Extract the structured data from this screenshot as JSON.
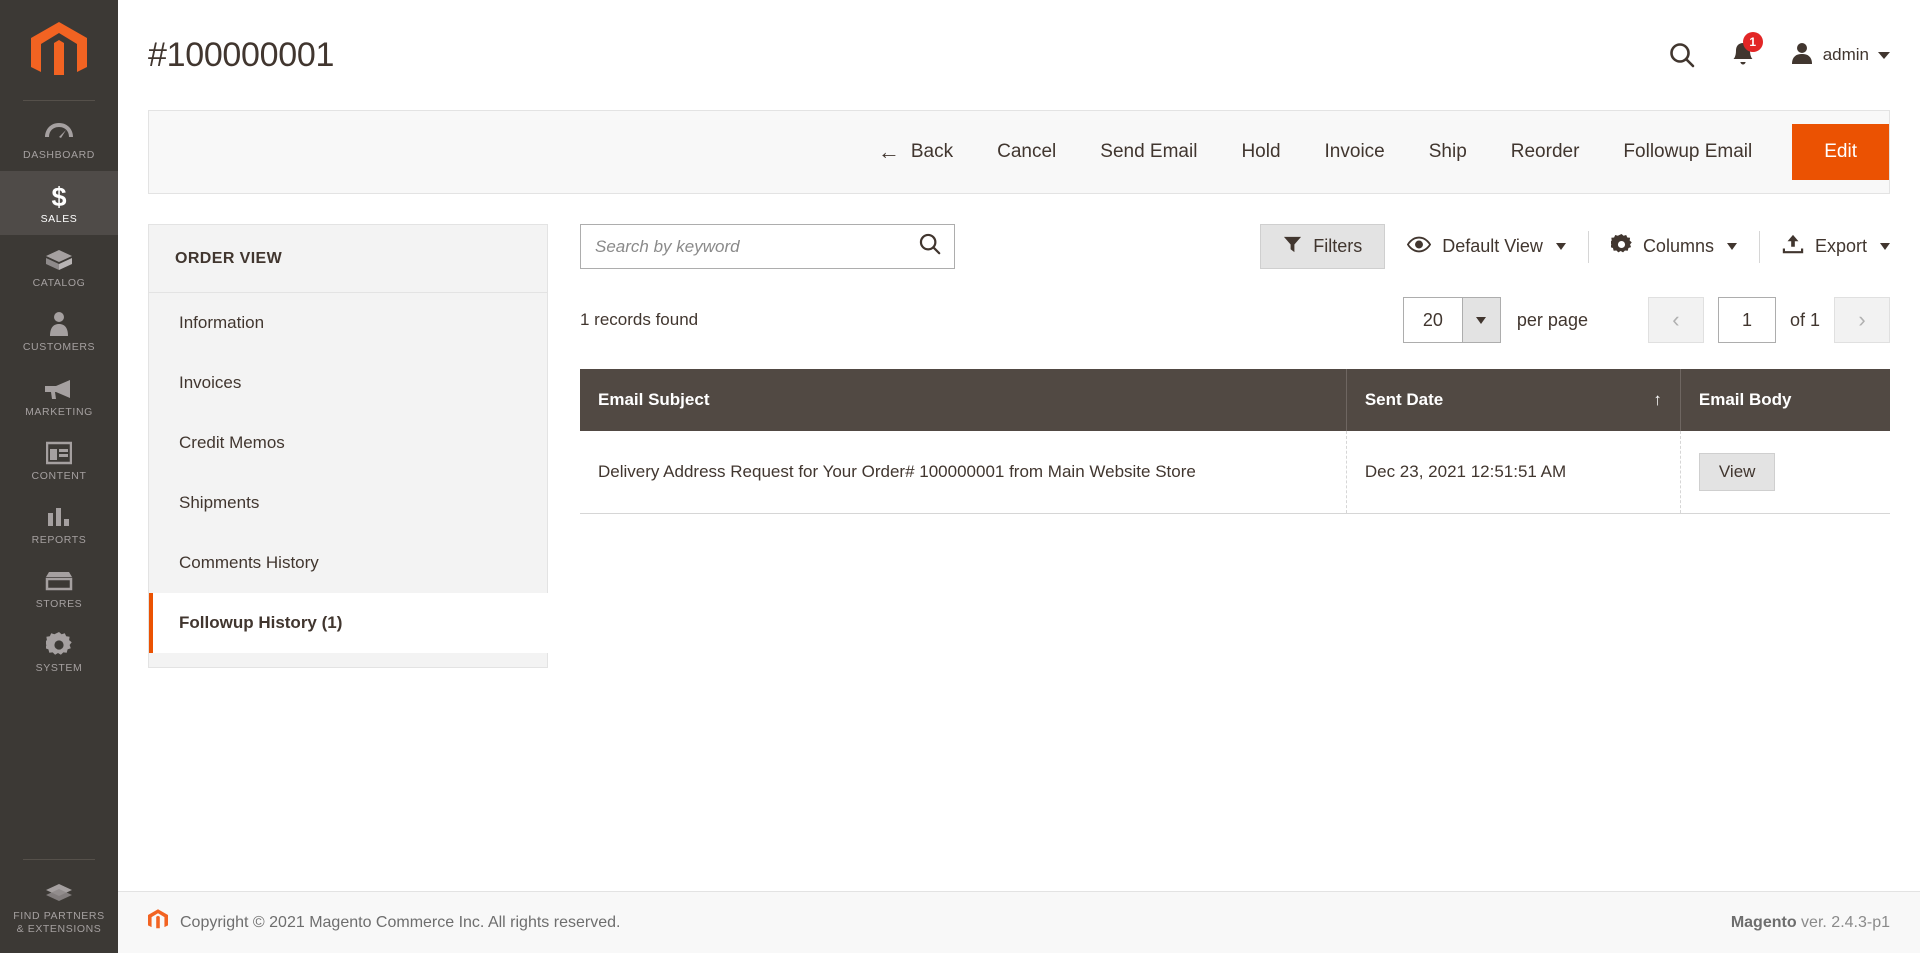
{
  "sidebar": {
    "logo": "magento-logo-icon",
    "items": [
      {
        "label": "DASHBOARD",
        "icon": "dashboard-icon",
        "active": false
      },
      {
        "label": "SALES",
        "icon": "dollar-icon",
        "active": true
      },
      {
        "label": "CATALOG",
        "icon": "box-icon",
        "active": false
      },
      {
        "label": "CUSTOMERS",
        "icon": "person-icon",
        "active": false
      },
      {
        "label": "MARKETING",
        "icon": "megaphone-icon",
        "active": false
      },
      {
        "label": "CONTENT",
        "icon": "layout-icon",
        "active": false
      },
      {
        "label": "REPORTS",
        "icon": "bar-chart-icon",
        "active": false
      },
      {
        "label": "STORES",
        "icon": "storefront-icon",
        "active": false
      },
      {
        "label": "SYSTEM",
        "icon": "gear-icon",
        "active": false
      }
    ],
    "bottom_item": {
      "label": "FIND PARTNERS\n& EXTENSIONS",
      "label_line1": "FIND PARTNERS",
      "label_line2": "& EXTENSIONS",
      "icon": "extensions-icon"
    }
  },
  "header": {
    "title": "#100000001",
    "search_icon": "search-icon",
    "notifications": {
      "icon": "bell-icon",
      "count": "1"
    },
    "user": {
      "icon": "user-avatar-icon",
      "name": "admin"
    }
  },
  "toolbar": {
    "back": "Back",
    "cancel": "Cancel",
    "send_email": "Send Email",
    "hold": "Hold",
    "invoice": "Invoice",
    "ship": "Ship",
    "reorder": "Reorder",
    "followup_email": "Followup Email",
    "edit": "Edit",
    "primary_color": "#eb5202"
  },
  "order_view": {
    "heading": "ORDER VIEW",
    "items": [
      {
        "label": "Information",
        "current": false
      },
      {
        "label": "Invoices",
        "current": false
      },
      {
        "label": "Credit Memos",
        "current": false
      },
      {
        "label": "Shipments",
        "current": false
      },
      {
        "label": "Comments History",
        "current": false
      },
      {
        "label": "Followup History (1)",
        "current": true
      }
    ],
    "active_indicator_color": "#eb5202"
  },
  "grid": {
    "search": {
      "placeholder": "Search by keyword",
      "value": "",
      "icon": "search-icon"
    },
    "filters_label": "Filters",
    "view_label": "Default View",
    "columns_label": "Columns",
    "export_label": "Export",
    "records_found": "1 records found",
    "per_page_value": "20",
    "per_page_label": "per page",
    "page_value": "1",
    "page_of": "of 1",
    "prev_icon": "chevron-left-icon",
    "next_icon": "chevron-right-icon",
    "columns": [
      {
        "label": "Email Subject",
        "sorted": false,
        "sort_arrow": ""
      },
      {
        "label": "Sent Date",
        "sorted": true,
        "sort_arrow": "↑"
      },
      {
        "label": "Email Body",
        "sorted": false,
        "sort_arrow": ""
      }
    ],
    "rows": [
      {
        "email_subject": "Delivery Address Request for Your Order# 100000001 from Main Website Store",
        "sent_date": "Dec 23, 2021 12:51:51 AM",
        "email_body_action": "View"
      }
    ],
    "header_bg": "#514943"
  },
  "footer": {
    "copyright": "Copyright © 2021 Magento Commerce Inc. All rights reserved.",
    "brand": "Magento",
    "version": " ver. 2.4.3-p1",
    "logo_icon": "magento-logo-icon"
  }
}
